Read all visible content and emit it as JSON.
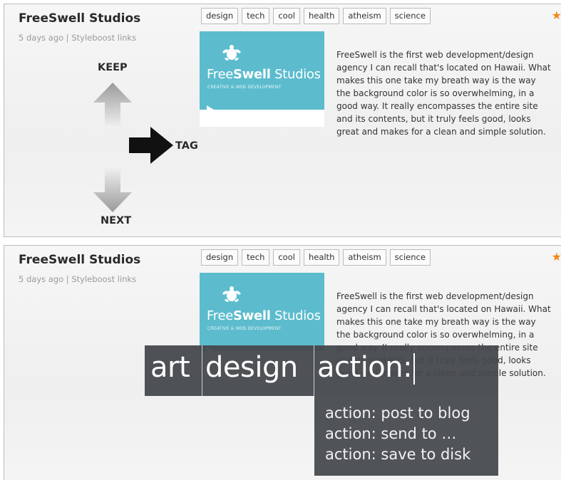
{
  "post": {
    "title": "FreeSwell Studios",
    "meta": "5 days ago | Styleboost links",
    "tags": [
      "design",
      "tech",
      "cool",
      "health",
      "atheism",
      "science"
    ],
    "description": "FreeSwell is the first web development/design agency I can recall that's located on Hawaii. What makes this one take my breath way is the way the background color is so overwhelming, in a good way. It really encompasses the entire site and its contents, but it truly feels good, looks great and makes for a clean and simple solution.",
    "thumbnail": {
      "brand_light": "Free",
      "brand_bold": "Swell",
      "brand_rest": " Studios",
      "tagline": "CREATIVE & WEB DEVELOPMENT",
      "color": "#5cbccd"
    },
    "star_icon": "star-icon",
    "star_color": "#f08a1a"
  },
  "gestures": {
    "keep": "KEEP",
    "tag": "TAG",
    "next": "NEXT"
  },
  "command": {
    "tokens": [
      "art",
      "design",
      "action:"
    ],
    "suggestions": [
      "action: post to blog",
      "action: send to …",
      "action: save to disk"
    ]
  }
}
